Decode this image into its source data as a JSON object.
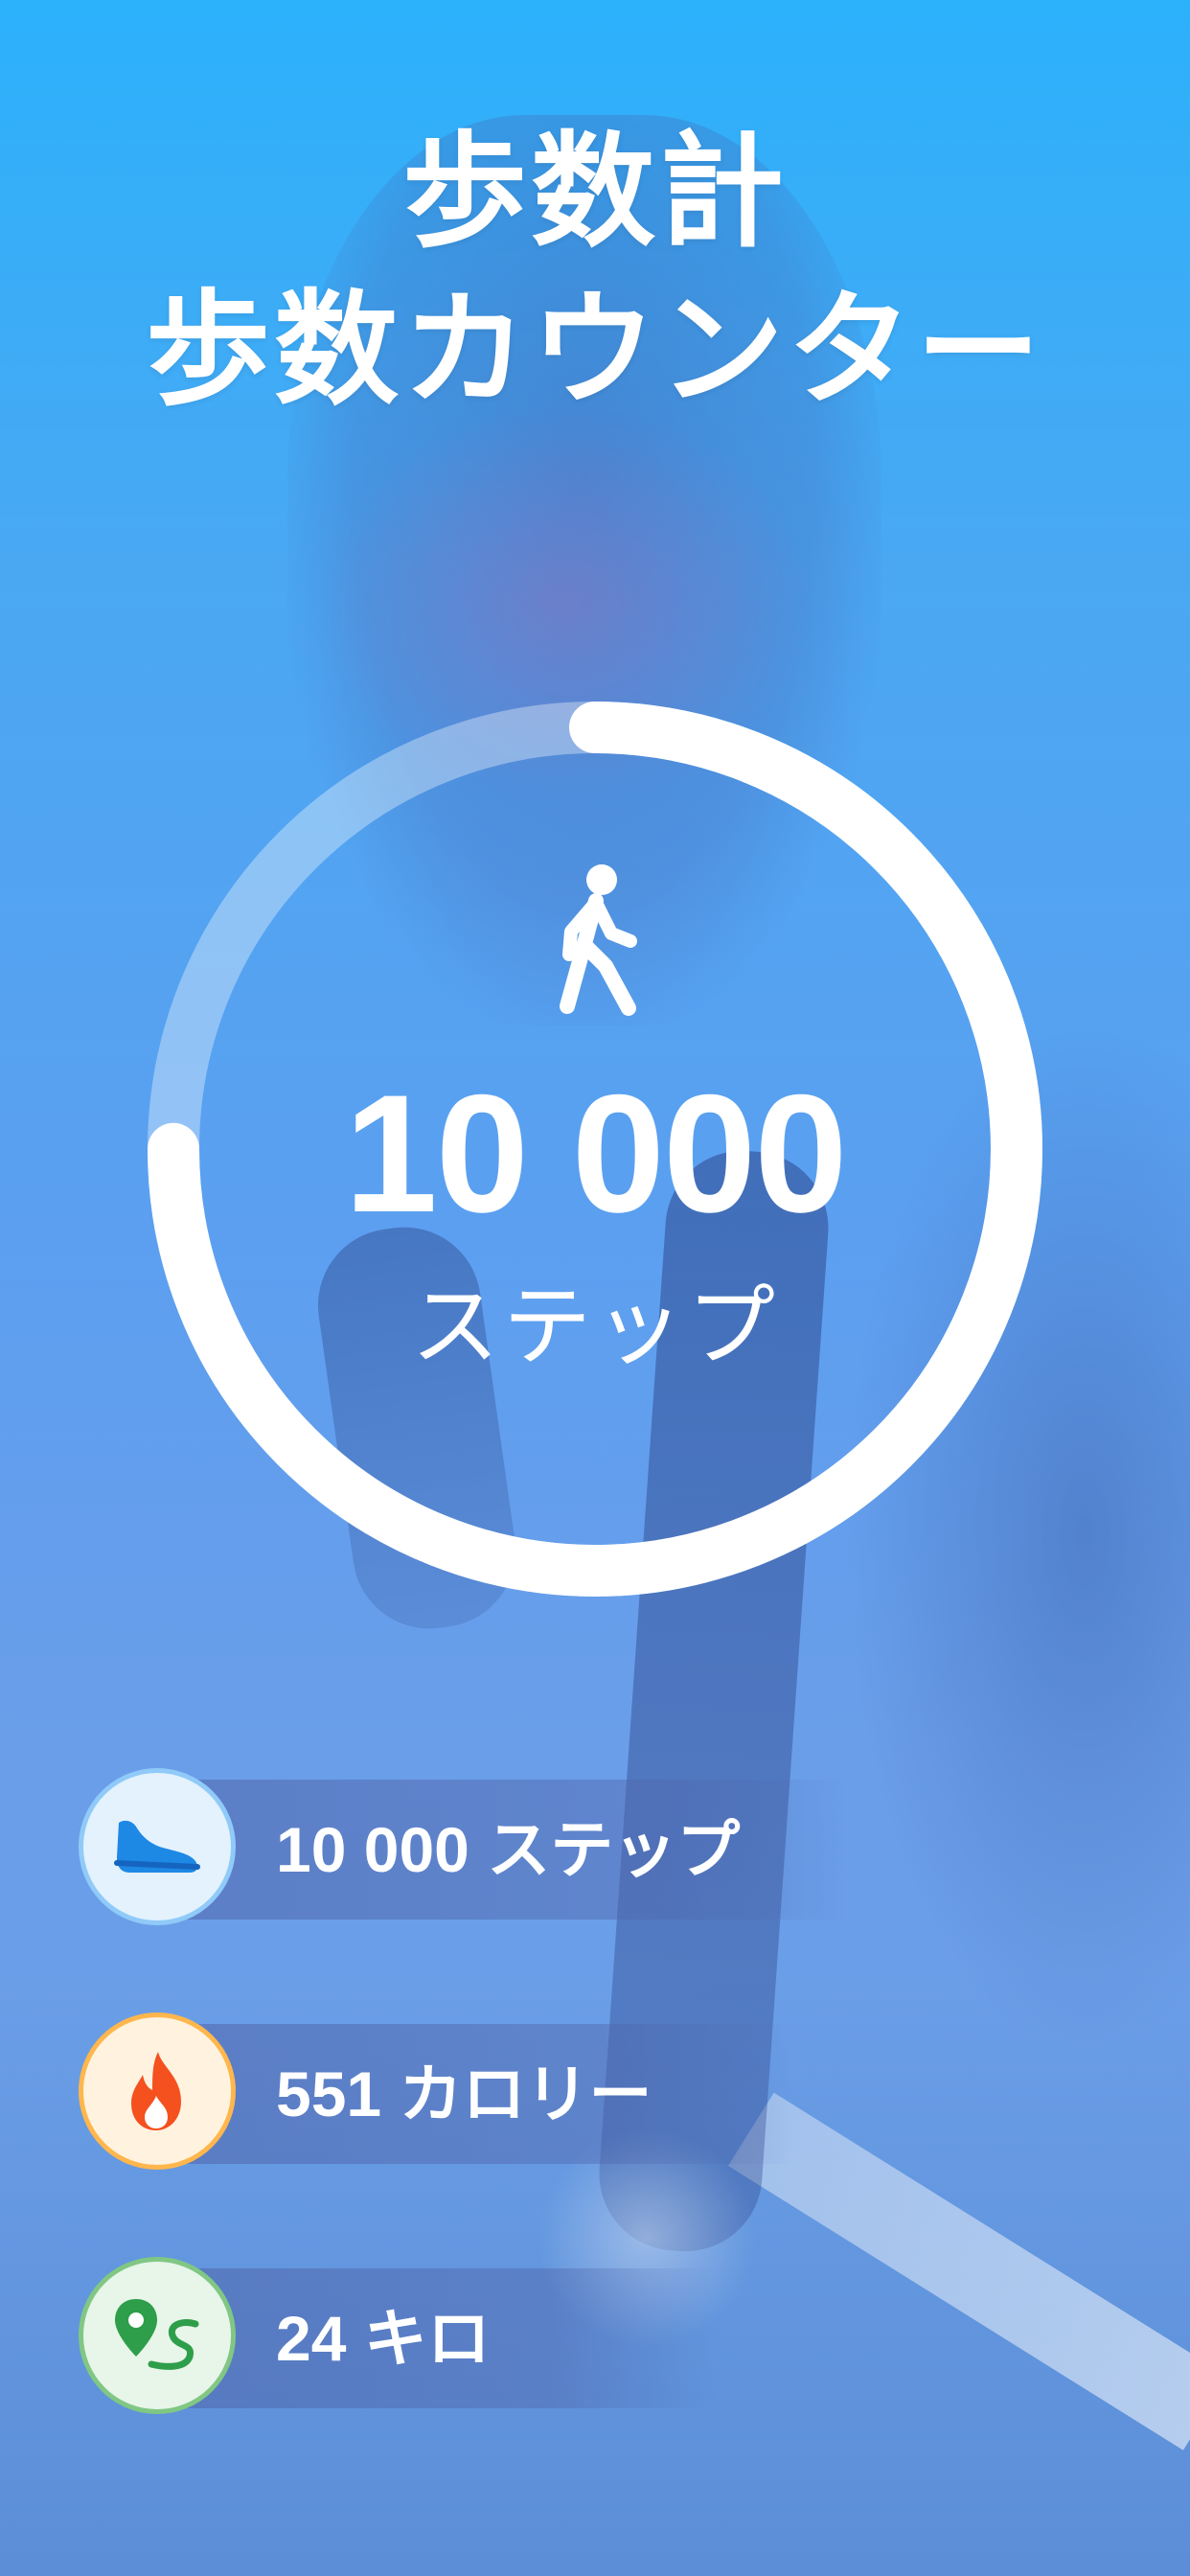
{
  "title": {
    "line1": "歩数計",
    "line2": "歩数カウンター"
  },
  "progress": {
    "icon": "walking-person-icon",
    "value": "10 000",
    "unit": "ステップ",
    "fraction": 0.75
  },
  "stats": [
    {
      "icon": "shoe-icon",
      "text": "10 000 ステップ",
      "icon_color": "#1e88e5",
      "circle_bg": "#e3f2fd",
      "circle_border": "#90caf9"
    },
    {
      "icon": "flame-icon",
      "text": "551 カロリー",
      "icon_color": "#f4511e",
      "circle_bg": "#fff3e0",
      "circle_border": "#ffb74d"
    },
    {
      "icon": "route-pin-icon",
      "text": "24 キロ",
      "icon_color": "#2e9e4a",
      "circle_bg": "#e8f5e9",
      "circle_border": "#81c784"
    }
  ],
  "colors": {
    "background_top": "#2cb1fb",
    "background_bottom": "#6b9fe3",
    "ring": "#ffffff"
  }
}
